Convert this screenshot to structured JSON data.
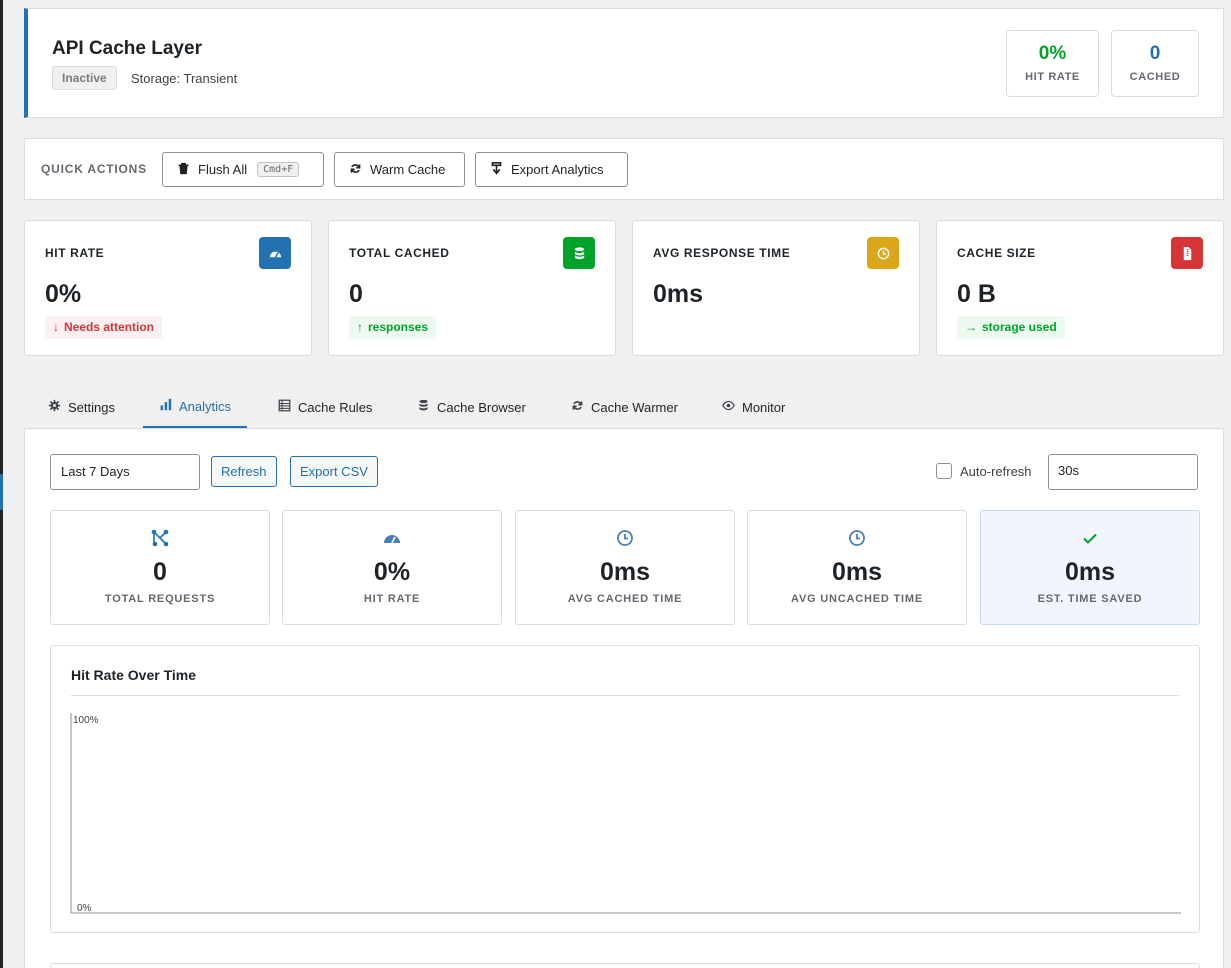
{
  "header": {
    "title": "API Cache Layer",
    "status": "Inactive",
    "storage": "Storage: Transient",
    "stats": [
      {
        "value": "0%",
        "label": "HIT RATE",
        "color": "#00a32a"
      },
      {
        "value": "0",
        "label": "CACHED",
        "color": "#2271b1"
      }
    ]
  },
  "quick_actions": {
    "label": "QUICK ACTIONS",
    "buttons": [
      {
        "label": "Flush All",
        "shortcut": "Cmd+F",
        "icon": "trash-icon"
      },
      {
        "label": "Warm Cache",
        "icon": "refresh-icon"
      },
      {
        "label": "Export Analytics",
        "icon": "download-icon"
      }
    ]
  },
  "cards": [
    {
      "title": "HIT RATE",
      "value": "0%",
      "badge": "Needs attention",
      "badge_type": "red",
      "icon": "dashboard-icon",
      "icon_color": "#2271b1"
    },
    {
      "title": "TOTAL CACHED",
      "value": "0",
      "badge": "responses",
      "badge_type": "green",
      "icon": "database-icon",
      "icon_color": "#00a32a"
    },
    {
      "title": "AVG RESPONSE TIME",
      "value": "0ms",
      "icon": "clock-icon",
      "icon_color": "#dba617"
    },
    {
      "title": "CACHE SIZE",
      "value": "0 B",
      "badge": "storage used",
      "badge_type": "green",
      "icon": "file-icon",
      "icon_color": "#d63638"
    }
  ],
  "tabs": [
    {
      "label": "Settings",
      "icon": "gear-icon"
    },
    {
      "label": "Analytics",
      "icon": "chart-bar-icon",
      "active": true
    },
    {
      "label": "Cache Rules",
      "icon": "list-icon"
    },
    {
      "label": "Cache Browser",
      "icon": "database-icon"
    },
    {
      "label": "Cache Warmer",
      "icon": "refresh-icon"
    },
    {
      "label": "Monitor",
      "icon": "eye-icon"
    }
  ],
  "analytics": {
    "range": "Last 7 Days",
    "refresh_label": "Refresh",
    "export_label": "Export CSV",
    "autorefresh_label": "Auto-refresh",
    "autorefresh_checked": false,
    "interval": "30s",
    "metrics": [
      {
        "value": "0",
        "label": "TOTAL REQUESTS",
        "icon": "network-icon"
      },
      {
        "value": "0%",
        "label": "HIT RATE",
        "icon": "dashboard-icon"
      },
      {
        "value": "0ms",
        "label": "AVG CACHED TIME",
        "icon": "clock-icon"
      },
      {
        "value": "0ms",
        "label": "AVG UNCACHED TIME",
        "icon": "clock-icon"
      },
      {
        "value": "0ms",
        "label": "EST. TIME SAVED",
        "icon": "check-icon"
      }
    ]
  },
  "chart_data": {
    "type": "line",
    "title": "Hit Rate Over Time",
    "ytick_labels": [
      "100%",
      "0%"
    ],
    "ylim": [
      0,
      100
    ],
    "series": []
  }
}
